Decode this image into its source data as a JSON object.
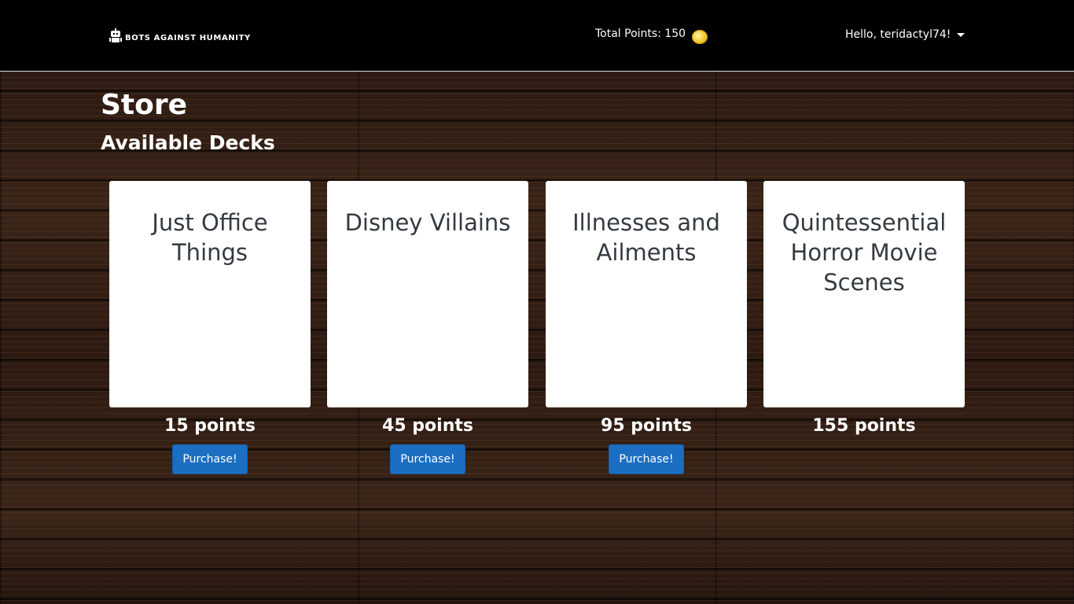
{
  "navbar": {
    "brand": "BOTS AGAINST HUMANITY",
    "brand_icon": "robot-icon",
    "points_label": "Total Points: 150",
    "coin_icon": "coin-icon",
    "user_greeting": "Hello, teridactyl74!",
    "user_menu_icon": "caret-down-icon"
  },
  "page": {
    "title": "Store",
    "section_title": "Available Decks"
  },
  "decks": [
    {
      "title": "Just Office Things",
      "price": "15 points",
      "button": "Purchase!"
    },
    {
      "title": "Disney Villains",
      "price": "45 points",
      "button": "Purchase!"
    },
    {
      "title": "Illnesses and Ailments",
      "price": "95 points",
      "button": "Purchase!"
    },
    {
      "title": "Quintessential Horror Movie Scenes",
      "price": "155 points",
      "button": ""
    }
  ],
  "colors": {
    "navbar_bg": "#000000",
    "button_bg": "#1b6ec2",
    "card_text": "#343a40",
    "coin": "#f4cf3a"
  }
}
